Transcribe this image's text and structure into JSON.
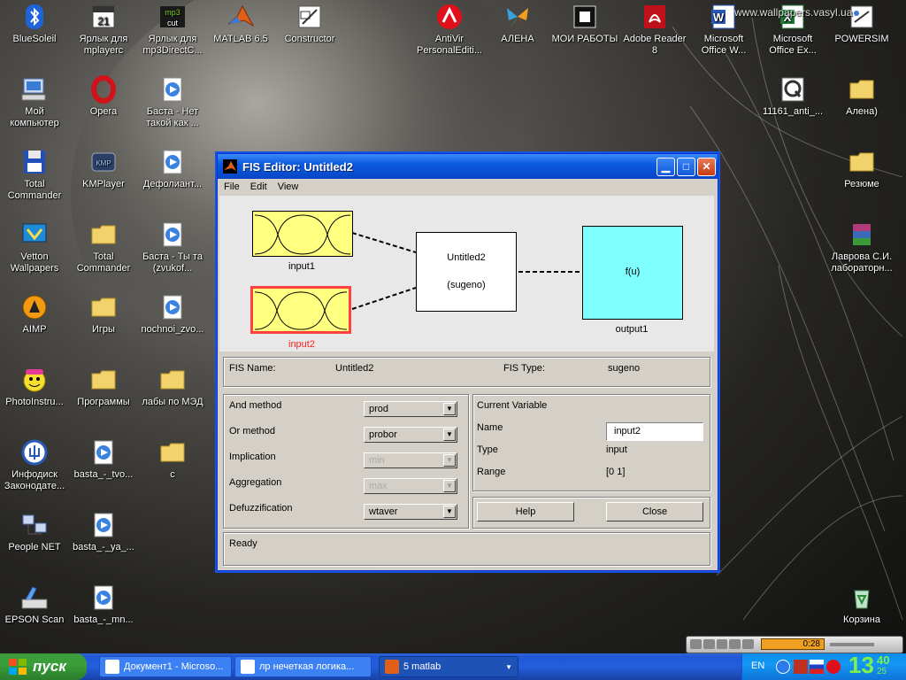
{
  "desktop": {
    "icons": [
      {
        "label": "BlueSoleil",
        "icon": "bluetooth-icon"
      },
      {
        "label": "Мой\nкомпьютер",
        "icon": "my-computer-icon"
      },
      {
        "label": "Total\nCommander",
        "icon": "floppy-icon"
      },
      {
        "label": "Vetton\nWallpapers",
        "icon": "wallpaper-icon"
      },
      {
        "label": "AIMP",
        "icon": "aimp-icon"
      },
      {
        "label": "PhotoInstru...",
        "icon": "smiley-icon"
      },
      {
        "label": "Инфодиск\nЗаконодате...",
        "icon": "trident-icon"
      },
      {
        "label": "People NET",
        "icon": "network-icon"
      },
      {
        "label": "EPSON Scan",
        "icon": "scanner-icon"
      },
      {
        "label": "Ярлык для\nmplayerc",
        "icon": "calendar-icon"
      },
      {
        "label": "Opera",
        "icon": "opera-icon"
      },
      {
        "label": "KMPlayer",
        "icon": "kmplayer-icon"
      },
      {
        "label": "Total\nCommander",
        "icon": "folder-icon"
      },
      {
        "label": "Игры",
        "icon": "folder-icon"
      },
      {
        "label": "Программы",
        "icon": "folder-icon"
      },
      {
        "label": "basta_-_tvo...",
        "icon": "media-file-icon"
      },
      {
        "label": "basta_-_ya_...",
        "icon": "media-file-icon"
      },
      {
        "label": "basta_-_mn...",
        "icon": "media-file-icon"
      },
      {
        "label": "Ярлык для\nmp3DirectC...",
        "icon": "mp3cut-icon"
      },
      {
        "label": "Баста - Нет\nтакой как ...",
        "icon": "media-file-icon"
      },
      {
        "label": "Дефолиант...",
        "icon": "media-file-icon"
      },
      {
        "label": "Баста - Ты та\n(zvukof...",
        "icon": "media-file-icon"
      },
      {
        "label": "nochnoi_zvo...",
        "icon": "media-file-icon"
      },
      {
        "label": "лабы по МЭД",
        "icon": "folder-icon"
      },
      {
        "label": "c",
        "icon": "folder-icon"
      },
      {
        "label": "MATLAB 6.5",
        "icon": "matlab-icon"
      },
      {
        "label": "Constructor",
        "icon": "constructor-icon"
      },
      {
        "label": "AntiVir\nPersonalEditi...",
        "icon": "antivir-icon"
      },
      {
        "label": "АЛЕНА",
        "icon": "butterfly-icon"
      },
      {
        "label": "МОИ РАБОТЫ",
        "icon": "works-icon"
      },
      {
        "label": "Adobe Reader\n8",
        "icon": "adobe-reader-icon"
      },
      {
        "label": "Microsoft\nOffice W...",
        "icon": "word-icon"
      },
      {
        "label": "Microsoft\nOffice Ex...",
        "icon": "excel-icon"
      },
      {
        "label": "POWERSIM",
        "icon": "powersim-icon"
      },
      {
        "label": "11161_anti_...",
        "icon": "quicktime-icon"
      },
      {
        "label": "Алена)",
        "icon": "folder-icon"
      },
      {
        "label": "Резюме",
        "icon": "folder-icon"
      },
      {
        "label": "Лаврова С.И.\nлабораторн...",
        "icon": "winrar-icon"
      },
      {
        "label": "Корзина",
        "icon": "recycle-bin-icon"
      }
    ],
    "watermark": "www.wallpapers.vasyl.ua"
  },
  "window": {
    "title": "FIS Editor: Untitled2",
    "menu": [
      "File",
      "Edit",
      "View"
    ],
    "diagram": {
      "input1": "input1",
      "input2": "input2",
      "system_name": "Untitled2",
      "system_type": "(sugeno)",
      "output_func": "f(u)",
      "output1": "output1"
    },
    "fis_name_label": "FIS Name:",
    "fis_name_value": "Untitled2",
    "fis_type_label": "FIS Type:",
    "fis_type_value": "sugeno",
    "methods": [
      {
        "label": "And method",
        "value": "prod",
        "enabled": true
      },
      {
        "label": "Or method",
        "value": "probor",
        "enabled": true
      },
      {
        "label": "Implication",
        "value": "min",
        "enabled": false
      },
      {
        "label": "Aggregation",
        "value": "max",
        "enabled": false
      },
      {
        "label": "Defuzzification",
        "value": "wtaver",
        "enabled": true
      }
    ],
    "current_variable": {
      "header": "Current Variable",
      "name_label": "Name",
      "name_value": "input2",
      "type_label": "Type",
      "type_value": "input",
      "range_label": "Range",
      "range_value": "[0 1]"
    },
    "help_button": "Help",
    "close_button": "Close",
    "status": "Ready"
  },
  "taskbar": {
    "start_label": "пуск",
    "tasks": [
      "Документ1 - Microso...",
      "лр нечеткая логика...",
      "5 matlab"
    ],
    "language": "EN",
    "clock_hours": "13",
    "clock_minutes": "40",
    "clock_seconds": "25",
    "player_time": "0:28"
  },
  "colors": {
    "mf_fill": "#ffff80",
    "output_fill": "#80ffff",
    "selected_border": "#ff4040",
    "selected_label": "#ff2020"
  }
}
